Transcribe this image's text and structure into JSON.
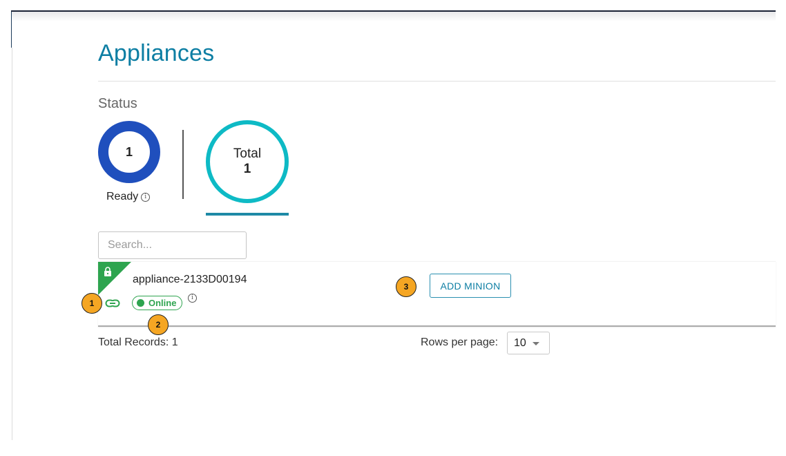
{
  "page": {
    "title": "Appliances"
  },
  "status": {
    "label": "Status",
    "ready": {
      "count": "1",
      "label": "Ready",
      "color": "#1f4fbd"
    },
    "total": {
      "label": "Total",
      "count": "1",
      "color": "#0ebac5"
    }
  },
  "search": {
    "placeholder": "Search...",
    "value": ""
  },
  "appliances": [
    {
      "name": "appliance-2133D00194",
      "status": "Online",
      "status_color": "#2ea44f",
      "locked": true,
      "action_label": "ADD MINION"
    }
  ],
  "annotations": [
    "1",
    "2",
    "3"
  ],
  "footer": {
    "total_records": "Total Records: 1",
    "rows_per_page_label": "Rows per page:",
    "rows_per_page_value": "10"
  },
  "icons": {
    "lock": "lock-icon",
    "link": "link-icon",
    "info": "info-icon",
    "caret": "caret-down-icon"
  }
}
